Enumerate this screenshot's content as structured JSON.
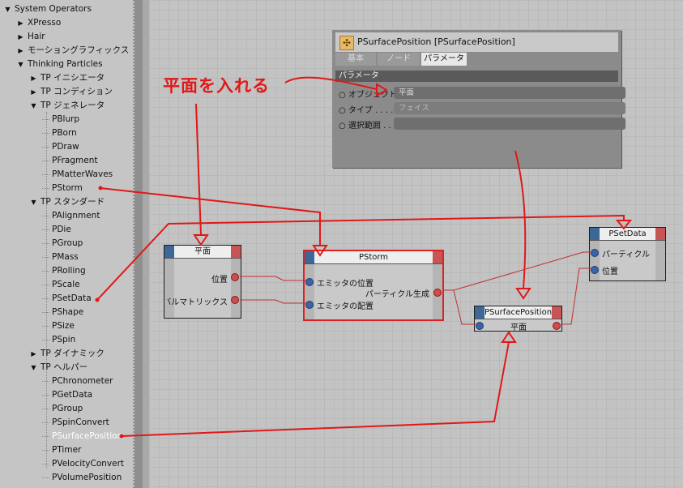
{
  "tree": {
    "items": [
      {
        "label": "System Operators",
        "expanded": true
      },
      {
        "label": "XPresso",
        "expanded": false
      },
      {
        "label": "Hair",
        "expanded": false
      },
      {
        "label": "モーショングラフィックス",
        "expanded": false
      },
      {
        "label": "Thinking Particles",
        "expanded": true
      },
      {
        "label": "TP イニシエータ",
        "expanded": false
      },
      {
        "label": "TP コンディション",
        "expanded": false
      },
      {
        "label": "TP ジェネレータ",
        "expanded": true
      },
      {
        "label": "PBlurp"
      },
      {
        "label": "PBorn"
      },
      {
        "label": "PDraw"
      },
      {
        "label": "PFragment"
      },
      {
        "label": "PMatterWaves"
      },
      {
        "label": "PStorm"
      },
      {
        "label": "TP スタンダード",
        "expanded": true
      },
      {
        "label": "PAlignment"
      },
      {
        "label": "PDie"
      },
      {
        "label": "PGroup"
      },
      {
        "label": "PMass"
      },
      {
        "label": "PRolling"
      },
      {
        "label": "PScale"
      },
      {
        "label": "PSetData"
      },
      {
        "label": "PShape"
      },
      {
        "label": "PSize"
      },
      {
        "label": "PSpin"
      },
      {
        "label": "TP ダイナミック",
        "expanded": false
      },
      {
        "label": "TP ヘルパー",
        "expanded": true
      },
      {
        "label": "PChronometer"
      },
      {
        "label": "PGetData"
      },
      {
        "label": "PGroup"
      },
      {
        "label": "PSpinConvert"
      },
      {
        "label": "PSurfacePosition",
        "selected": true
      },
      {
        "label": "PTimer"
      },
      {
        "label": "PVelocityConvert"
      },
      {
        "label": "PVolumePosition"
      }
    ]
  },
  "attributes": {
    "title": "PSurfacePosition [PSurfacePosition]",
    "tabs": [
      "基本",
      "ノード",
      "パラメータ"
    ],
    "active_tab": "パラメータ",
    "section": "パラメータ",
    "rows": [
      {
        "label": "オブジェクト",
        "value": "平面"
      },
      {
        "label": "タイプ . . . .",
        "value": "フェイス"
      },
      {
        "label": "選択範囲 . . .",
        "value": ""
      }
    ]
  },
  "nodes": {
    "plane": {
      "title": "平面",
      "ports": [
        "位置",
        "グローバルマトリックス"
      ]
    },
    "pstorm": {
      "title": "PStorm",
      "inputs": [
        "エミッタの位置",
        "エミッタの配置"
      ],
      "output": "パーティクル生成"
    },
    "psurface": {
      "title": "PSurfacePosition",
      "port": "平面"
    },
    "psetdata": {
      "title": "PSetData",
      "inputs": [
        "パーティクル",
        "位置"
      ]
    }
  },
  "annotation": "平面を入れる",
  "colors": {
    "annotation": "#e01818",
    "port_in": "#3a64a8",
    "port_out": "#d24b4b",
    "selection": "#d22222"
  }
}
